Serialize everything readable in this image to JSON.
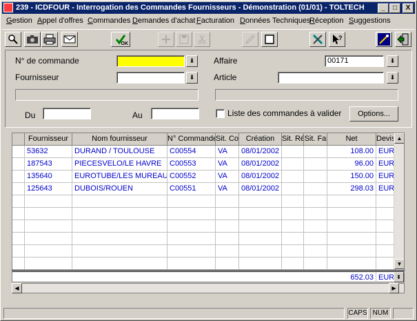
{
  "window": {
    "title": "239 - ICDFOUR - Interrogation des Commandes Fournisseurs - Démonstration (01/01) - TOLTECH",
    "min_label": "_",
    "max_label": "□",
    "close_label": "X"
  },
  "menu": [
    {
      "label": "Gestion"
    },
    {
      "label": "Appel d'offres"
    },
    {
      "label": "Commandes"
    },
    {
      "label": "Demandes d'achat"
    },
    {
      "label": "Facturation"
    },
    {
      "label": "Données Techniques"
    },
    {
      "label": "Réception"
    },
    {
      "label": "Suggestions"
    }
  ],
  "toolbar": {
    "ok_label": "OK"
  },
  "form": {
    "commande_label": "N° de commande",
    "commande_value": "",
    "fournisseur_label": "Fournisseur",
    "fournisseur_value": "",
    "affaire_label": "Affaire",
    "affaire_value": "00171",
    "article_label": "Article",
    "article_value": "",
    "du_label": "Du",
    "du_value": "",
    "au_label": "Au",
    "au_value": "",
    "checkbox_label": "Liste des commandes à valider",
    "checkbox_checked": false,
    "options_label": "Options..."
  },
  "grid": {
    "columns": [
      "Fournisseur",
      "Nom fournisseur",
      "N° Commande",
      "Sit. Co",
      "Création",
      "Sit. Ré",
      "Sit. Fa",
      "Net",
      "Devis"
    ],
    "rows": [
      [
        "53632",
        "DURAND / TOULOUSE",
        "C00554",
        "VA",
        "08/01/2002",
        "",
        "",
        "108.00",
        "EUR"
      ],
      [
        "187543",
        "PIECESVELO/LE HAVRE",
        "C00553",
        "VA",
        "08/01/2002",
        "",
        "",
        "96.00",
        "EUR"
      ],
      [
        "135640",
        "EUROTUBE/LES MUREAUX",
        "C00552",
        "VA",
        "08/01/2002",
        "",
        "",
        "150.00",
        "EUR"
      ],
      [
        "125643",
        "DUBOIS/ROUEN",
        "C00551",
        "VA",
        "08/01/2002",
        "",
        "",
        "298.03",
        "EUR"
      ]
    ],
    "total_net": "652.03",
    "total_currency": "EUR"
  },
  "status": {
    "caps": "CAPS",
    "num": "NUM"
  }
}
